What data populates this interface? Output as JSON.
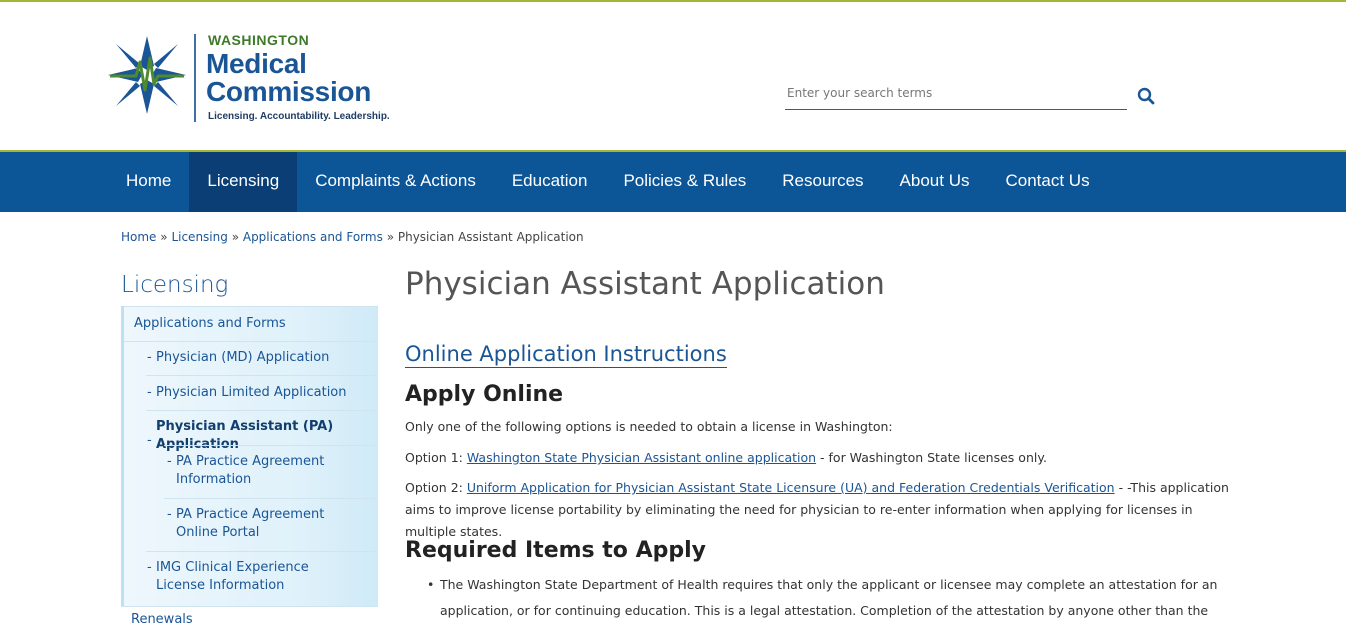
{
  "header": {
    "logo": {
      "line1": "WASHINGTON",
      "line2": "Medical",
      "line3": "Commission",
      "tagline": "Licensing. Accountability. Leadership."
    },
    "search": {
      "placeholder": "Enter your search terms",
      "value": ""
    },
    "search_icon": "search-icon",
    "colors": {
      "accent_green": "#a5b53a",
      "brand_blue": "#0c5597",
      "active_blue": "#0a3e74"
    }
  },
  "nav": {
    "items": [
      {
        "label": "Home"
      },
      {
        "label": "Licensing",
        "active": true
      },
      {
        "label": "Complaints & Actions"
      },
      {
        "label": "Education"
      },
      {
        "label": "Policies & Rules"
      },
      {
        "label": "Resources"
      },
      {
        "label": "About Us"
      },
      {
        "label": "Contact Us"
      }
    ]
  },
  "breadcrumb": {
    "items": [
      "Home",
      "Licensing",
      "Applications and Forms"
    ],
    "separator": "»",
    "current": "Physician Assistant Application"
  },
  "sidebar": {
    "title": "Licensing",
    "section": "Applications and Forms",
    "items": [
      {
        "label": "Physician (MD) Application"
      },
      {
        "label": "Physician Limited Application"
      },
      {
        "label": "Physician Assistant (PA) Application",
        "current": true
      },
      {
        "label": "PA Practice Agreement Information"
      },
      {
        "label": "PA Practice Agreement Online Portal"
      },
      {
        "label": "IMG Clinical Experience License Information"
      }
    ],
    "bullet": "-",
    "next_section": "Renewals"
  },
  "main": {
    "title": "Physician Assistant Application",
    "instructions_link": "Online Application Instructions",
    "apply_heading": "Apply Online",
    "intro": "Only one of the following options is needed to obtain a license in Washington:",
    "option1": {
      "prefix": "Option 1: ",
      "link": "Washington State Physician Assistant online application",
      "suffix": " - for Washington State licenses only."
    },
    "option2": {
      "prefix": "Option 2: ",
      "link": "Uniform Application for Physician Assistant State Licensure (UA) and Federation Credentials Verification",
      "suffix": " - -This application aims to improve license portability by eliminating the need for physician to re-enter information when applying for licenses in multiple states."
    },
    "required_heading": "Required Items to Apply",
    "bullets": [
      "The Washington State Department of Health requires that only the applicant or licensee may complete an attestation for an application, or for continuing education. This is a legal attestation. Completion of the attestation by anyone other than the applicant"
    ]
  }
}
